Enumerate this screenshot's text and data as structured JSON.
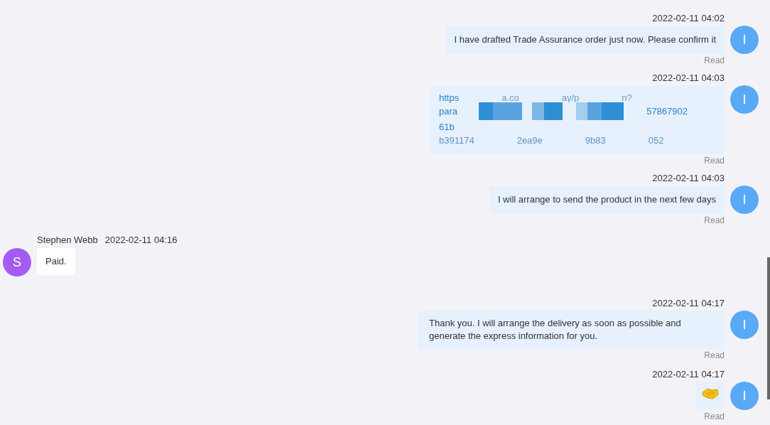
{
  "messages": [
    {
      "kind": "text",
      "time": "2022-02-11 04:02",
      "text": "I have drafted Trade Assurance order just now. Please confirm it",
      "status": "Read",
      "avatar": {
        "letter": "I",
        "color": "#5aa9f5"
      }
    },
    {
      "kind": "link",
      "time": "2022-02-11 04:03",
      "lines": [
        [
          "https",
          "a.co",
          "ay/p",
          "n?"
        ],
        [
          "para",
          "57867902"
        ],
        [
          "61b"
        ],
        [
          "b391174",
          "2ea9e",
          "9b83",
          "052"
        ]
      ],
      "status": "Read",
      "avatar": {
        "letter": "I",
        "color": "#5aa9f5"
      }
    },
    {
      "kind": "text",
      "time": "2022-02-11 04:03",
      "text": "I will arrange to send the product in the next few days",
      "status": "Read",
      "avatar": {
        "letter": "I",
        "color": "#5aa9f5"
      }
    },
    {
      "kind": "text",
      "sender": "Stephen Webb",
      "time": "2022-02-11 04:16",
      "text": "Paid.",
      "avatar": {
        "letter": "S",
        "color": "#a35cf0"
      }
    },
    {
      "kind": "text",
      "time": "2022-02-11 04:17",
      "text": "Thank you. I will arrange the delivery as soon as possible and generate the express information for you.",
      "status": "Read",
      "avatar": {
        "letter": "I",
        "color": "#5aa9f5"
      }
    },
    {
      "kind": "sticker",
      "time": "2022-02-11 04:17",
      "status": "Read",
      "avatar": {
        "letter": "I",
        "color": "#5aa9f5"
      }
    }
  ]
}
